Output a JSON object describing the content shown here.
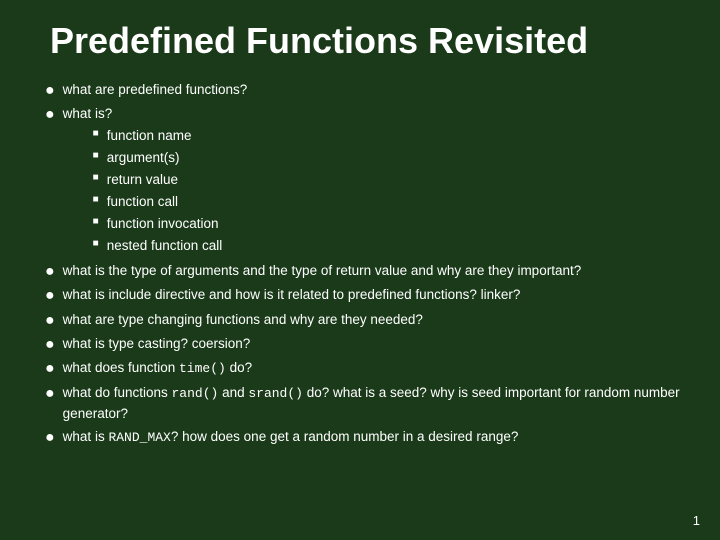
{
  "slide": {
    "title": "Predefined Functions Revisited",
    "bullets": [
      {
        "id": "b1",
        "text": "what are predefined functions?"
      },
      {
        "id": "b2",
        "text": "what is?",
        "sub": [
          "function name",
          "argument(s)",
          "return value",
          "function call",
          "function invocation",
          "nested function call"
        ]
      },
      {
        "id": "b3",
        "text": "what is the type of arguments and the type of return value and why are they important?"
      },
      {
        "id": "b4",
        "text": "what is include directive and how is it related to predefined functions? linker?"
      },
      {
        "id": "b5",
        "text": "what are type changing functions and why are they needed?"
      },
      {
        "id": "b6",
        "text": "what is type casting? coersion?"
      },
      {
        "id": "b7",
        "text_parts": [
          "what does function ",
          "time()",
          " do?"
        ],
        "has_code": true
      },
      {
        "id": "b8",
        "text_parts": [
          "what do functions ",
          "rand()",
          " and ",
          "srand()",
          " do? what is a seed? why is seed important for random number generator?"
        ],
        "has_code": true
      },
      {
        "id": "b9",
        "text_parts": [
          "what is ",
          "RAND_MAX",
          "? how does one get a random number in a desired range?"
        ],
        "has_code": true
      }
    ],
    "page_number": "1"
  }
}
